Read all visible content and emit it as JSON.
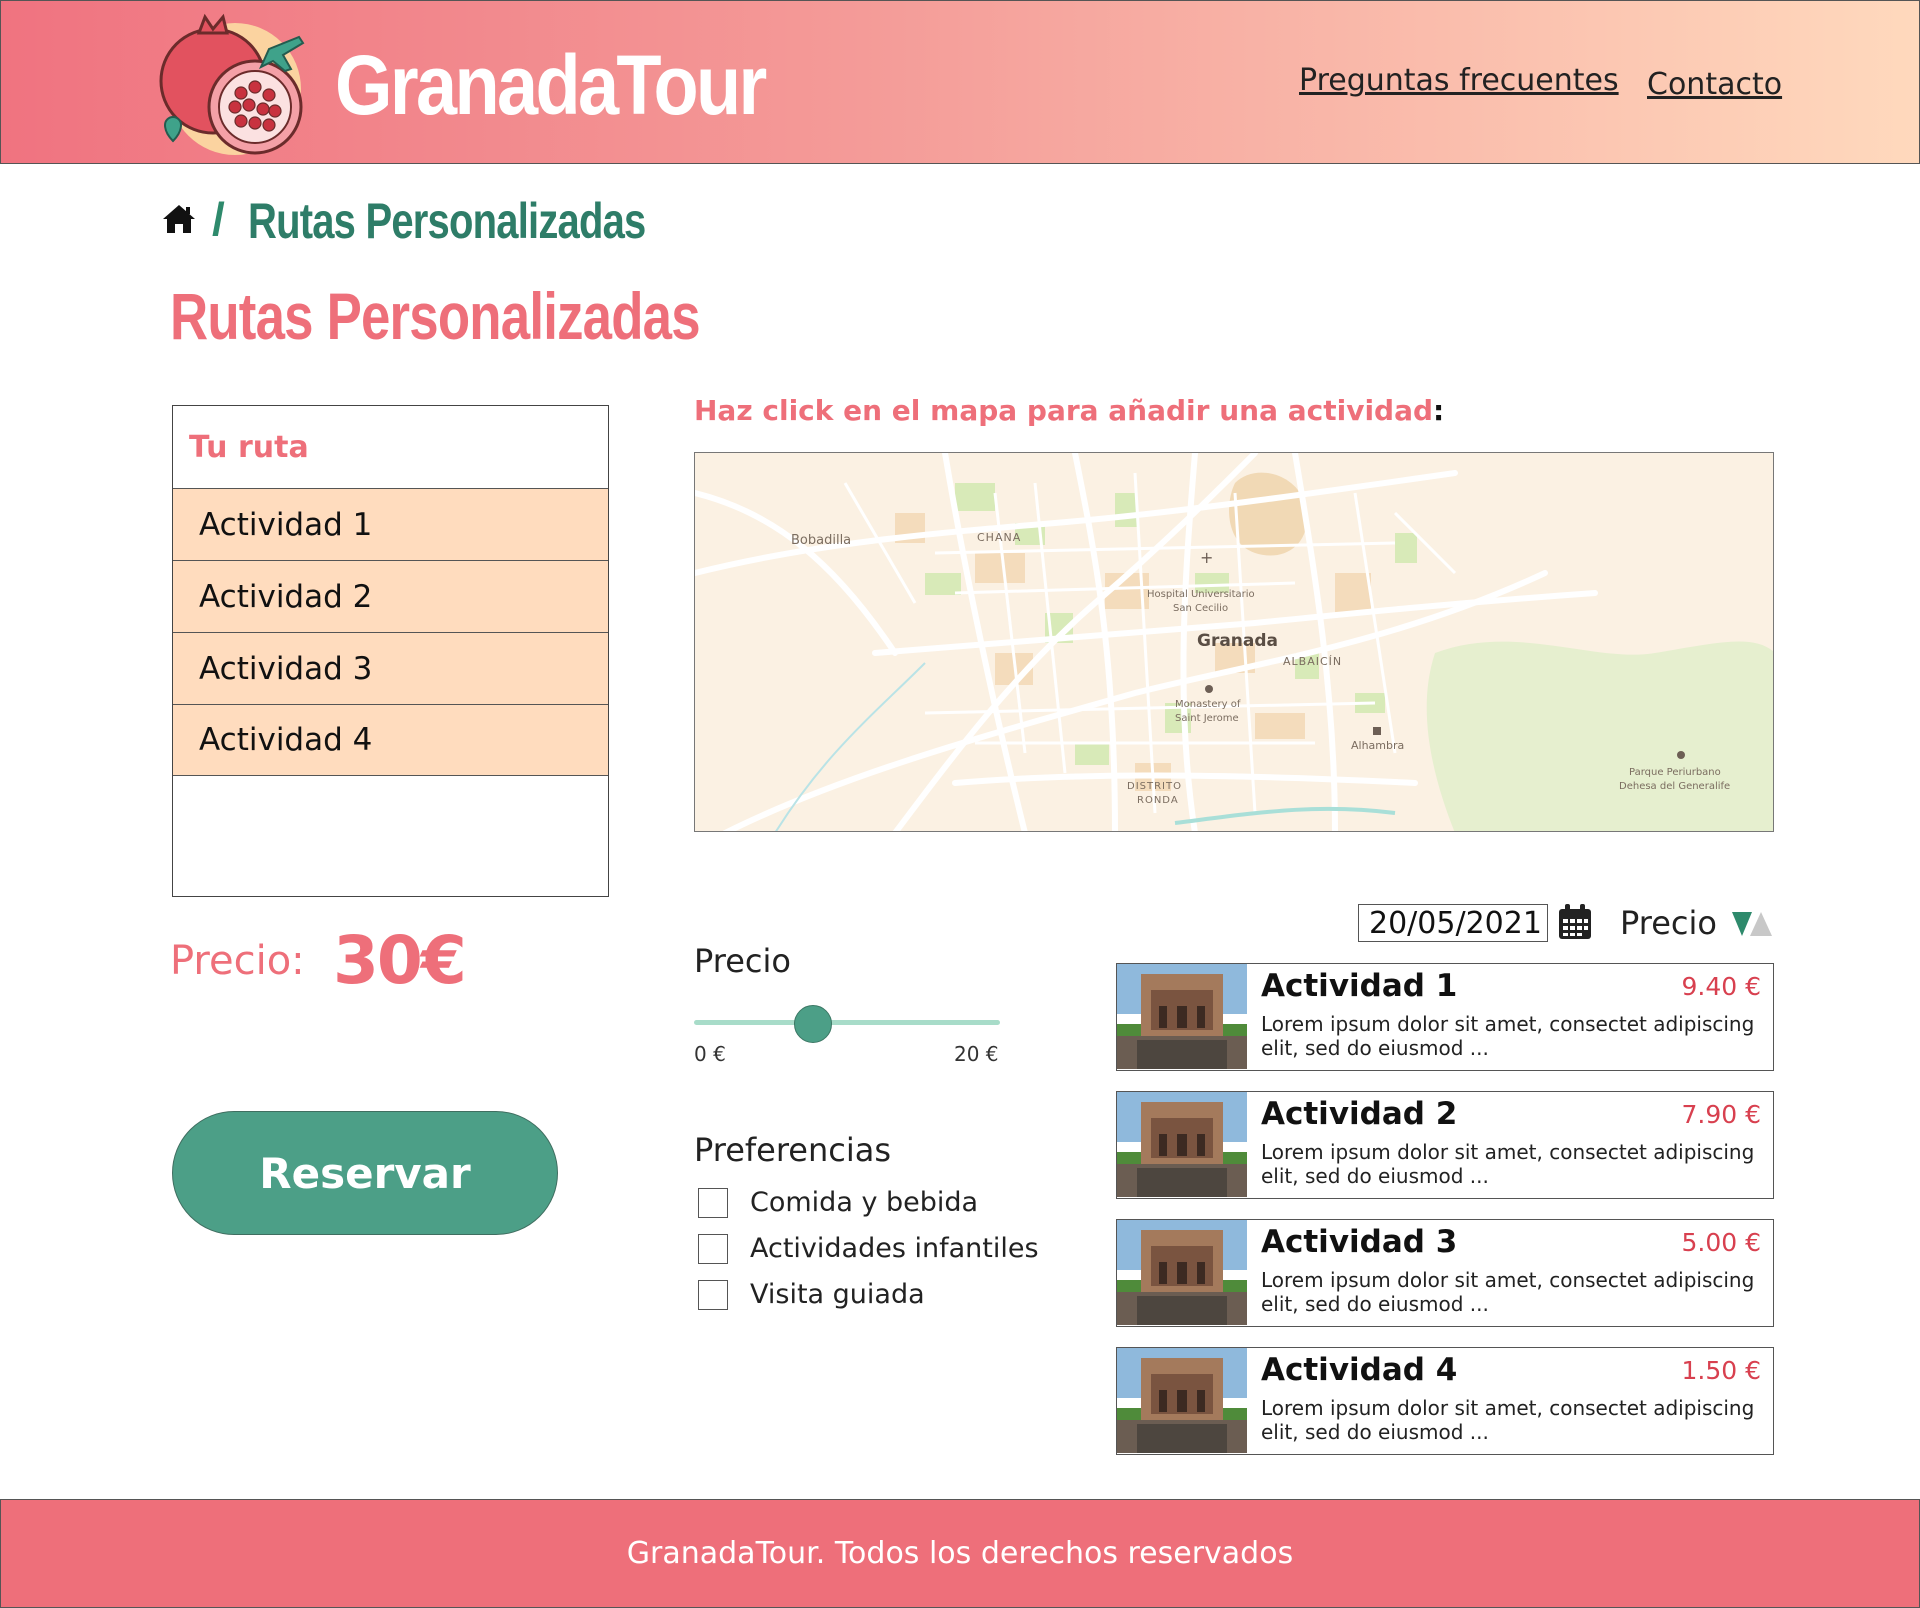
{
  "header": {
    "brand": "GranadaTour",
    "nav": {
      "faq": "Preguntas frecuentes",
      "contact": "Contacto"
    },
    "logo_icon": "pomegranate-airplane-logo"
  },
  "breadcrumb": {
    "separator": "/",
    "current": "Rutas Personalizadas",
    "home_icon": "home-icon"
  },
  "page_title": "Rutas Personalizadas",
  "route": {
    "title": "Tu ruta",
    "items": [
      "Actividad 1",
      "Actividad 2",
      "Actividad 3",
      "Actividad 4"
    ],
    "price_label": "Precio:",
    "price_value": "30€",
    "reserve_label": "Reservar"
  },
  "map": {
    "hint": "Haz click en el mapa para añadir una actividad",
    "hint_colon": ":",
    "labels": {
      "bobadilla": "Bobadilla",
      "chana": "CHANA",
      "hospital_line1": "Hospital Universitario",
      "hospital_line2": "San Cecilio",
      "granada": "Granada",
      "albaicin": "ALBAICÍN",
      "monastery_line1": "Monastery of",
      "monastery_line2": "Saint Jerome",
      "alhambra": "Alhambra",
      "distrito_line1": "DISTRITO",
      "distrito_line2": "RONDA",
      "parque_line1": "Parque Periurbano",
      "parque_line2": "Dehesa del Generalife"
    }
  },
  "filters": {
    "price_title": "Precio",
    "slider_min": "0 €",
    "slider_max": "20 €",
    "slider_value_fraction": 0.39,
    "preferences_title": "Preferencias",
    "preferences": [
      {
        "label": "Comida y bebida",
        "checked": false
      },
      {
        "label": "Actividades infantiles",
        "checked": false
      },
      {
        "label": "Visita guiada",
        "checked": false
      }
    ]
  },
  "listing": {
    "date": "20/05/2021",
    "sort_label": "Precio",
    "activities": [
      {
        "name": "Actividad 1",
        "price": "9.40 €",
        "desc": "Lorem ipsum dolor sit amet, consectet adipiscing elit, sed do eiusmod ..."
      },
      {
        "name": "Actividad 2",
        "price": "7.90 €",
        "desc": "Lorem ipsum dolor sit amet, consectet adipiscing elit, sed do eiusmod ..."
      },
      {
        "name": "Actividad 3",
        "price": "5.00 €",
        "desc": "Lorem ipsum dolor sit amet, consectet adipiscing elit, sed do eiusmod ..."
      },
      {
        "name": "Actividad 4",
        "price": "1.50 €",
        "desc": "Lorem ipsum dolor sit amet, consectet adipiscing elit, sed do eiusmod ..."
      }
    ]
  },
  "footer": {
    "text": "GranadaTour. Todos los derechos reservados"
  },
  "colors": {
    "accent_pink": "#ee6f7a",
    "green": "#4c9f87",
    "peach": "#ffdcbe",
    "dark_green_text": "#2e7d68",
    "price_red": "#d8404f"
  }
}
